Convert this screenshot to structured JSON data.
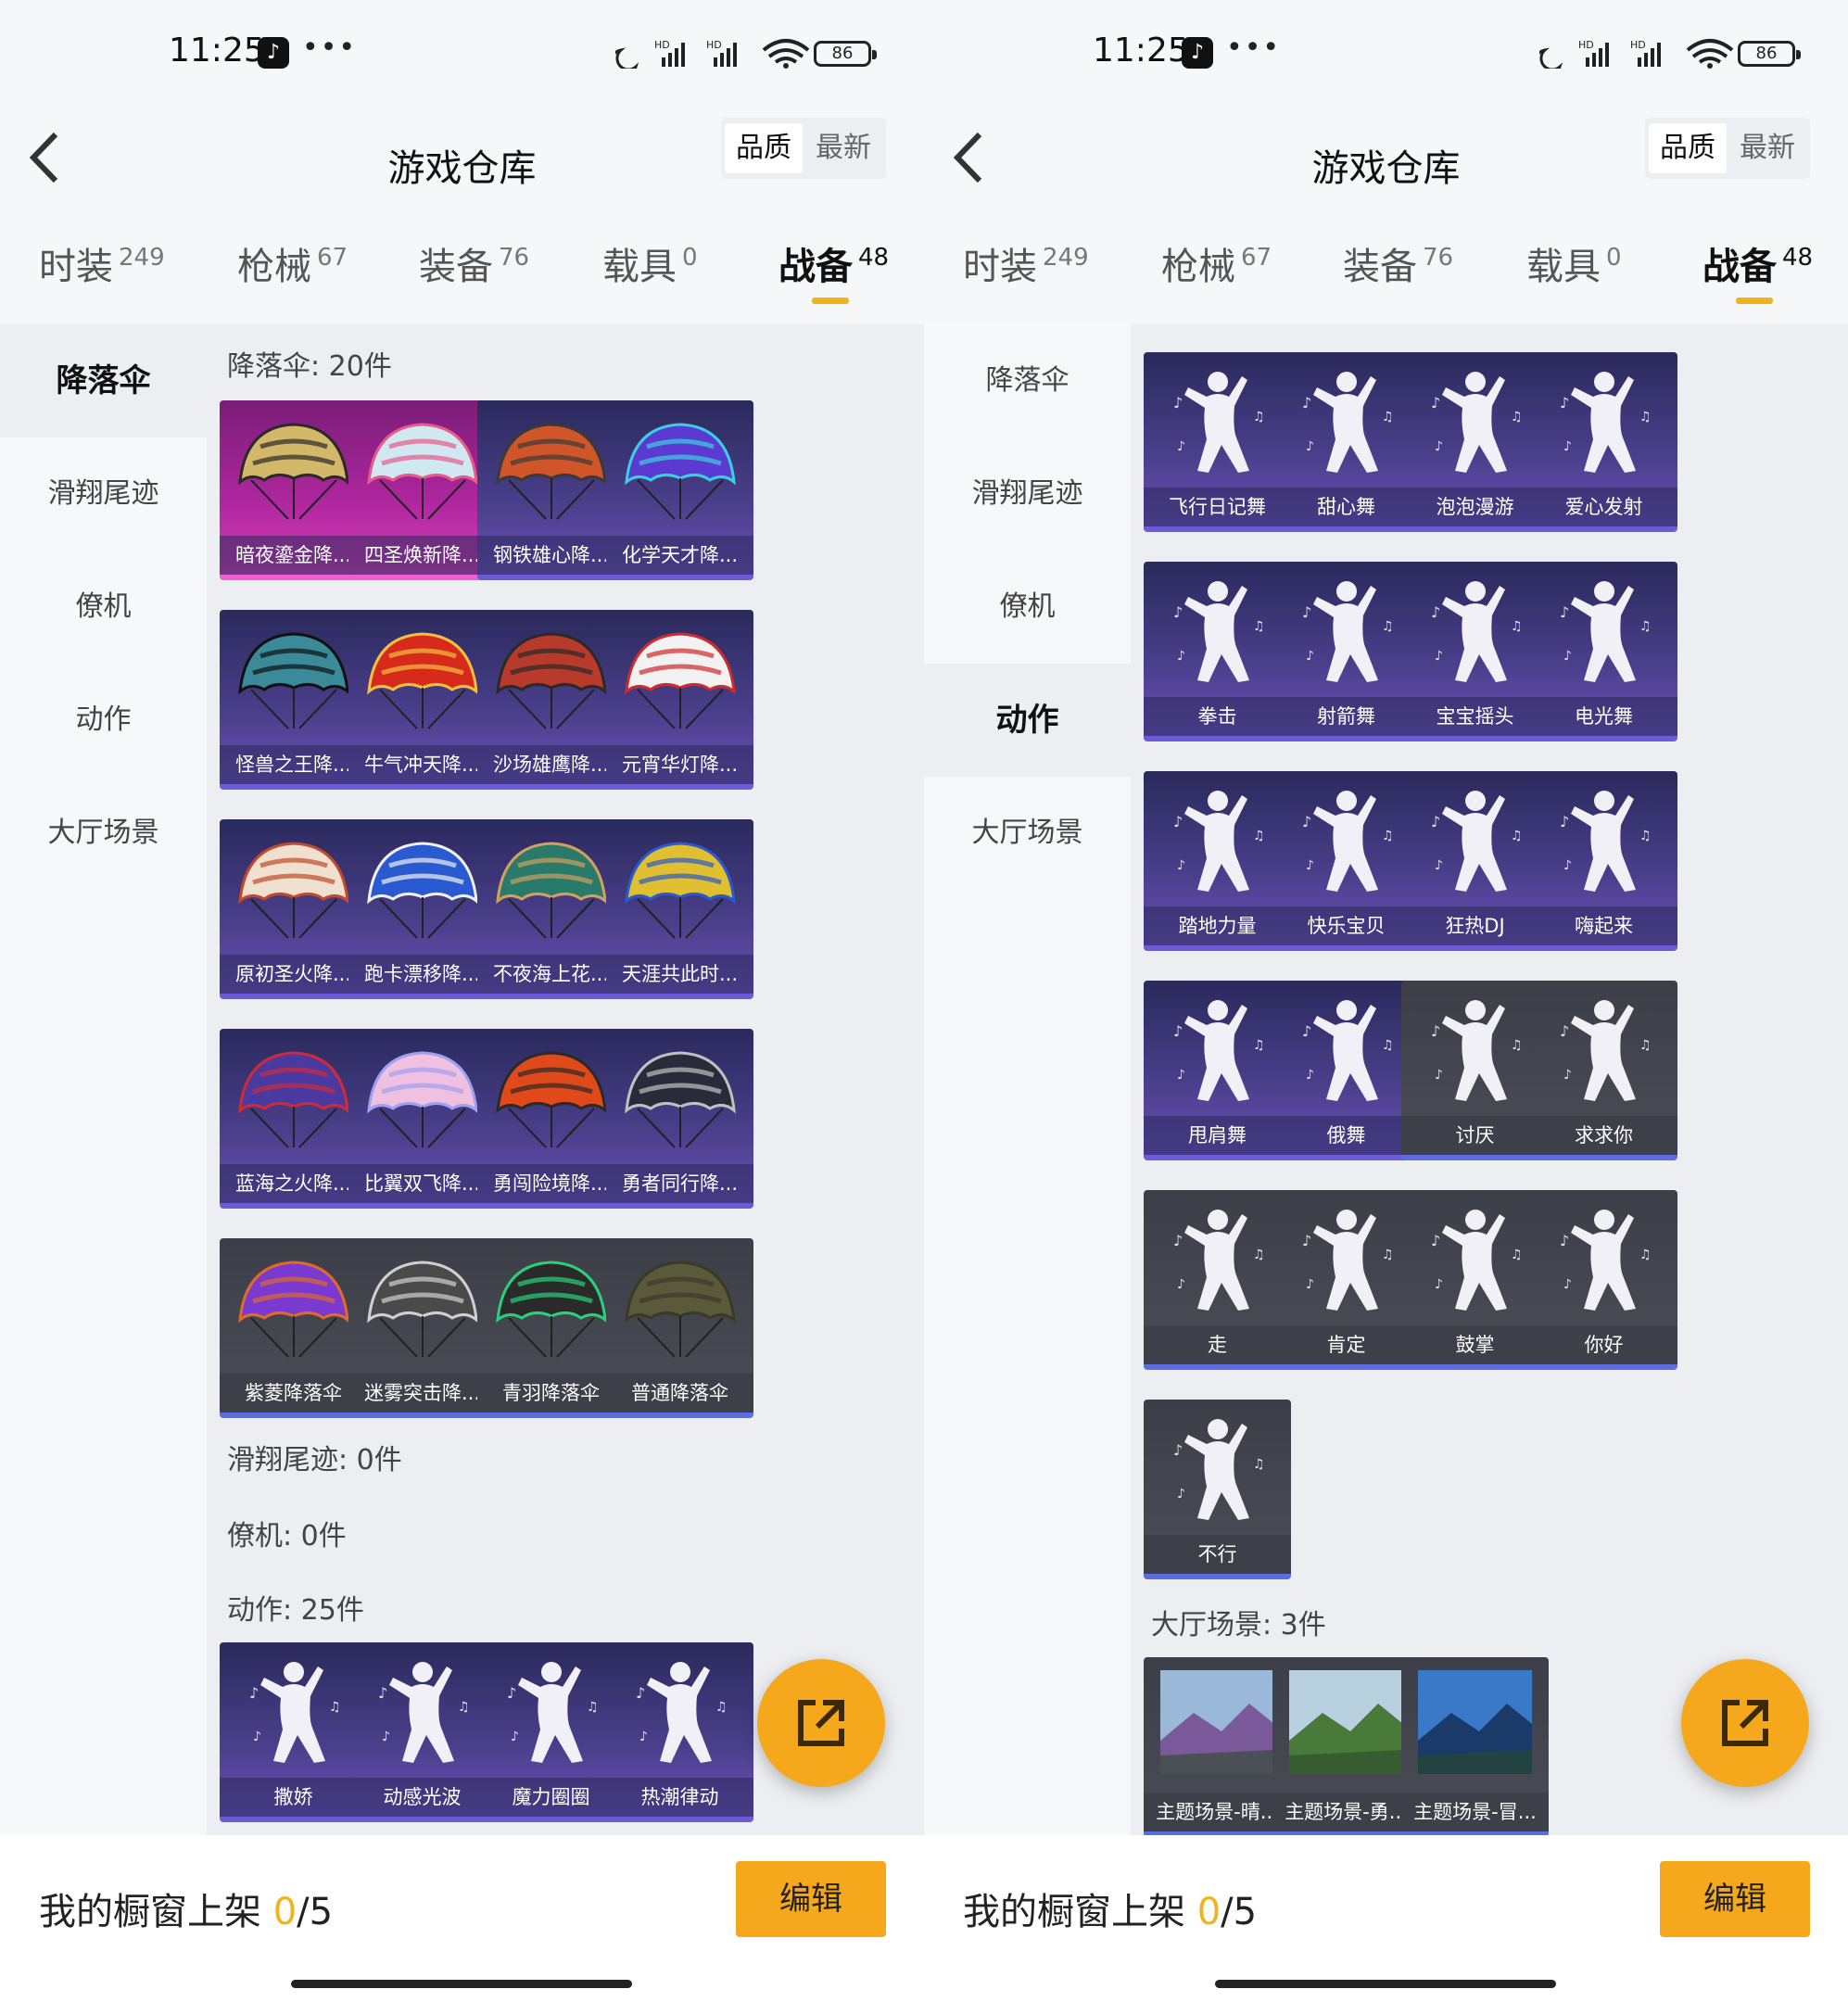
{
  "status_bar": {
    "time": "11:25",
    "battery": "86"
  },
  "header": {
    "title": "游戏仓库",
    "sort_quality": "品质",
    "sort_newest": "最新"
  },
  "tabs": [
    {
      "label": "时装",
      "count": "249"
    },
    {
      "label": "枪械",
      "count": "67"
    },
    {
      "label": "装备",
      "count": "76"
    },
    {
      "label": "载具",
      "count": "0"
    },
    {
      "label": "战备",
      "count": "48"
    }
  ],
  "sidebar": [
    "降落伞",
    "滑翔尾迹",
    "僚机",
    "动作",
    "大厅场景"
  ],
  "left": {
    "sec_parachute": "降落伞: 20件",
    "parachutes": [
      "暗夜鎏金降...",
      "四圣焕新降...",
      "钢铁雄心降...",
      "化学天才降...",
      "怪兽之王降...",
      "牛气冲天降...",
      "沙场雄鹰降...",
      "元宵华灯降...",
      "原初圣火降...",
      "跑卡漂移降...",
      "不夜海上花...",
      "天涯共此时...",
      "蓝海之火降...",
      "比翼双飞降...",
      "勇闯险境降...",
      "勇者同行降...",
      "紫菱降落伞",
      "迷雾突击降...",
      "青羽降落伞",
      "普通降落伞"
    ],
    "sec_trail": "滑翔尾迹: 0件",
    "sec_wingman": "僚机: 0件",
    "sec_emote": "动作: 25件",
    "emotes": [
      "撒娇",
      "动感光波",
      "魔力圈圈",
      "热潮律动"
    ]
  },
  "right": {
    "emotes": [
      "飞行日记舞",
      "甜心舞",
      "泡泡漫游",
      "爱心发射",
      "拳击",
      "射箭舞",
      "宝宝摇头",
      "电光舞",
      "踏地力量",
      "快乐宝贝",
      "狂热DJ",
      "嗨起来",
      "甩肩舞",
      "俄舞",
      "讨厌",
      "求求你",
      "走",
      "肯定",
      "鼓掌",
      "你好",
      "不行"
    ],
    "sec_lobby": "大厅场景: 3件",
    "lobby": [
      "主题场景-晴...",
      "主题场景-勇...",
      "主题场景-冒..."
    ]
  },
  "bottom": {
    "shelf_label": "我的橱窗上架 ",
    "shelf_count": "0",
    "shelf_total": "/5",
    "edit": "编辑"
  }
}
